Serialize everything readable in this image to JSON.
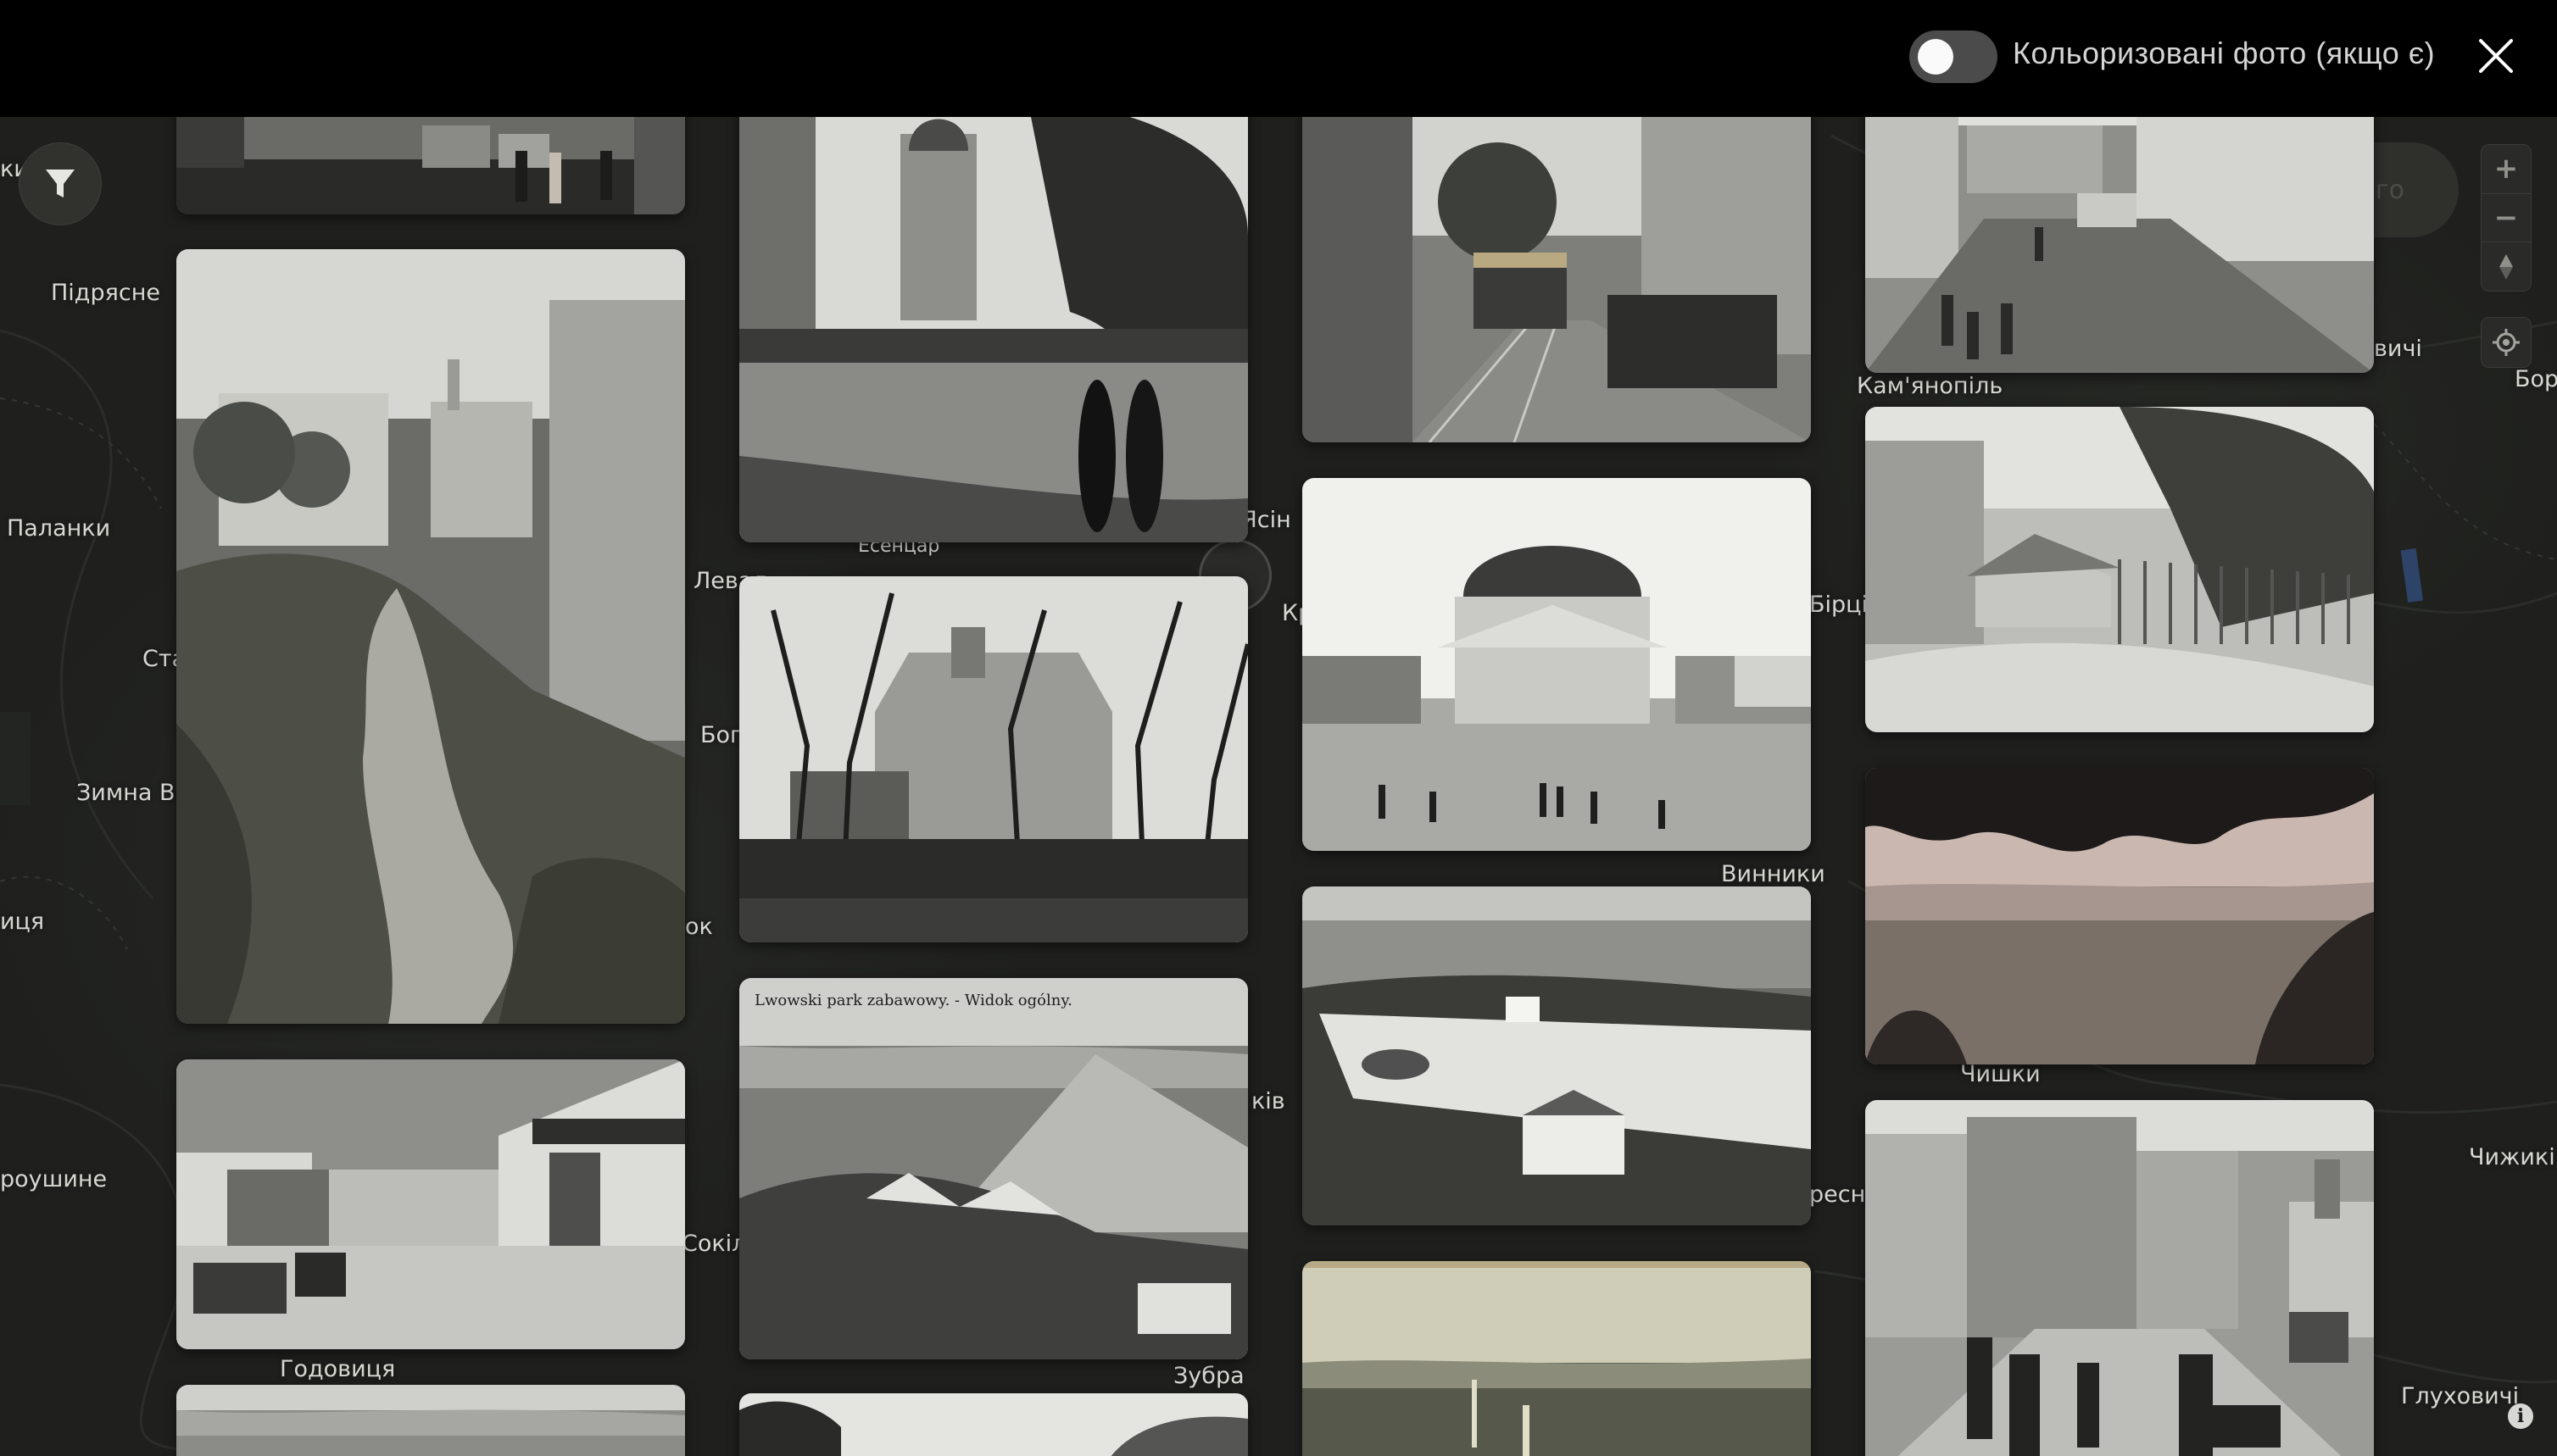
{
  "topbar": {
    "toggle_label": "Кольоризовані фото (якщо є)",
    "toggle_on": false,
    "close_icon": "close-icon"
  },
  "map": {
    "search_ghost_text": "го",
    "controls": {
      "zoom_in": "+",
      "zoom_out": "−",
      "compass": "compass-icon",
      "locate": "locate-icon",
      "filter": "filter-icon",
      "info": "i"
    },
    "labels": [
      "Підрясне",
      "Паланки",
      "Зимна Во",
      "иця",
      "роушине",
      "Годовиця",
      "Сокіл",
      "Зубра",
      "Винники",
      "Кам'янопіль",
      "Чишки",
      "Чижиків",
      "Глуховичі",
      "Бор",
      "вичі",
      "Бірці",
      "Левад",
      "Богд",
      "Ста",
      "ків",
      "Кр",
      "ресни",
      "Ясін",
      "ок",
      "ки",
      "Есенцар"
    ]
  },
  "gallery": {
    "photos": [
      {
        "id": "p1",
        "scene": "street-tram-cars"
      },
      {
        "id": "p2",
        "scene": "hillside-ravine-buildings"
      },
      {
        "id": "p3",
        "scene": "street-horse-carts"
      },
      {
        "id": "p4",
        "scene": "panorama-plain"
      },
      {
        "id": "p5",
        "scene": "couple-walking-church-tower"
      },
      {
        "id": "p6",
        "scene": "church-behind-trees-crowd"
      },
      {
        "id": "p7",
        "scene": "park-panorama-postcard",
        "caption": "Lwowski park zabawowy. - Widok ogólny."
      },
      {
        "id": "p8",
        "scene": "trees-top"
      },
      {
        "id": "p9",
        "scene": "tram-street-crowd"
      },
      {
        "id": "p10",
        "scene": "domed-synagogue-square"
      },
      {
        "id": "p11",
        "scene": "amusement-park-aerial"
      },
      {
        "id": "p12",
        "scene": "city-panorama-sepia"
      },
      {
        "id": "p13",
        "scene": "muddy-street-wooden-houses"
      },
      {
        "id": "p14",
        "scene": "old-houses-fence-trees"
      },
      {
        "id": "p15",
        "scene": "view-through-leaves-plain"
      },
      {
        "id": "p16",
        "scene": "market-street-townhouses"
      }
    ]
  }
}
